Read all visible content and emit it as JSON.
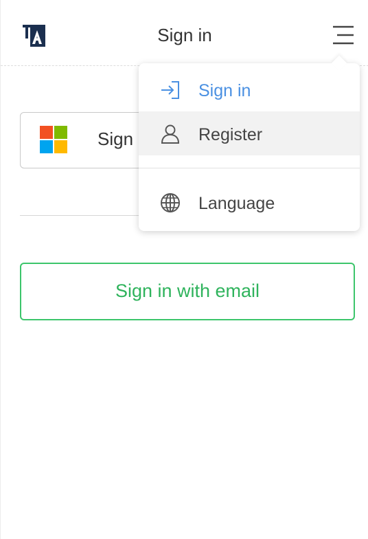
{
  "header": {
    "title": "Sign in",
    "logo_icon": "ta-logo",
    "menu_icon": "hamburger-menu-icon"
  },
  "main": {
    "microsoft_button": {
      "label": "Sign",
      "icon": "microsoft-logo-icon"
    },
    "email_button": {
      "label": "Sign in with email"
    }
  },
  "dropdown": {
    "items": [
      {
        "label": "Sign in",
        "icon": "sign-in-icon",
        "active": true
      },
      {
        "label": "Register",
        "icon": "user-icon",
        "hovered": true
      },
      {
        "label": "Language",
        "icon": "globe-icon"
      }
    ]
  },
  "colors": {
    "accent_blue": "#4a90e2",
    "accent_green": "#3cc56b",
    "logo_navy": "#1b2f4f"
  }
}
